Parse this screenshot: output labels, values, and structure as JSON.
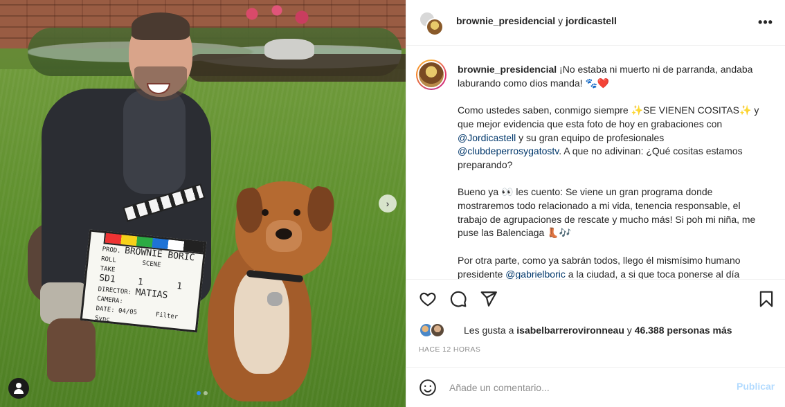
{
  "header": {
    "user1": "brownie_presidencial",
    "joiner": "y",
    "user2": "jordicastell",
    "more_icon": "more-horizontal-icon"
  },
  "photo": {
    "clapper": {
      "prod_label": "PROD.",
      "prod_value": "BROWNIE BORIC",
      "roll_label": "ROLL",
      "roll_value": "SD1",
      "scene_label": "SCENE",
      "scene_value": "1",
      "take_label": "TAKE",
      "take_value": "1",
      "director_label": "DIRECTOR:",
      "director_value": "MATIAS",
      "camera_label": "CAMERA:",
      "date_label": "DATE:",
      "date_value": "04/05",
      "filter_label": "Filter",
      "sync_label": "Sync"
    },
    "carousel_total": 2,
    "carousel_active": 1
  },
  "caption": {
    "username": "brownie_presidencial",
    "line1": " ¡No estaba ni muerto ni de parranda, andaba laburando como dios manda! 🐾❤️",
    "p2_a": "Como ustedes saben, conmigo siempre ✨SE VIENEN COSITAS✨ y que mejor evidencia que esta foto de hoy en grabaciones con ",
    "p2_mention1": "@Jordicastell",
    "p2_b": " y su gran equipo de profesionales ",
    "p2_mention2": "@clubdeperrosygatostv",
    "p2_c": ". A que no adivinan: ¿Qué cositas estamos preparando?",
    "p3": "Bueno ya 👀 les cuento: Se viene un gran programa donde mostraremos todo relacionado a mi vida, tenencia responsable, el trabajo de agrupaciones de rescate y mucho más! Si poh mi niña, me puse las Balenciaga 👢🎶",
    "p4_a": "Por otra parte, como ya sabrán todos, llego él mismísimo humano presidente ",
    "p4_mention": "@gabrielboric",
    "p4_b": " a la ciudad, a si que toca ponerse al día"
  },
  "actions": {
    "like_icon": "heart-icon",
    "comment_icon": "comment-icon",
    "share_icon": "send-icon",
    "save_icon": "bookmark-icon"
  },
  "likes": {
    "prefix": "Les gusta a ",
    "user": "isabelbarrerovironneau",
    "middle": " y ",
    "count": "46.388 personas más"
  },
  "timestamp": "HACE 12 HORAS",
  "comment": {
    "placeholder": "Añade un comentario...",
    "post_label": "Publicar",
    "post_color": "#b3dbff"
  }
}
